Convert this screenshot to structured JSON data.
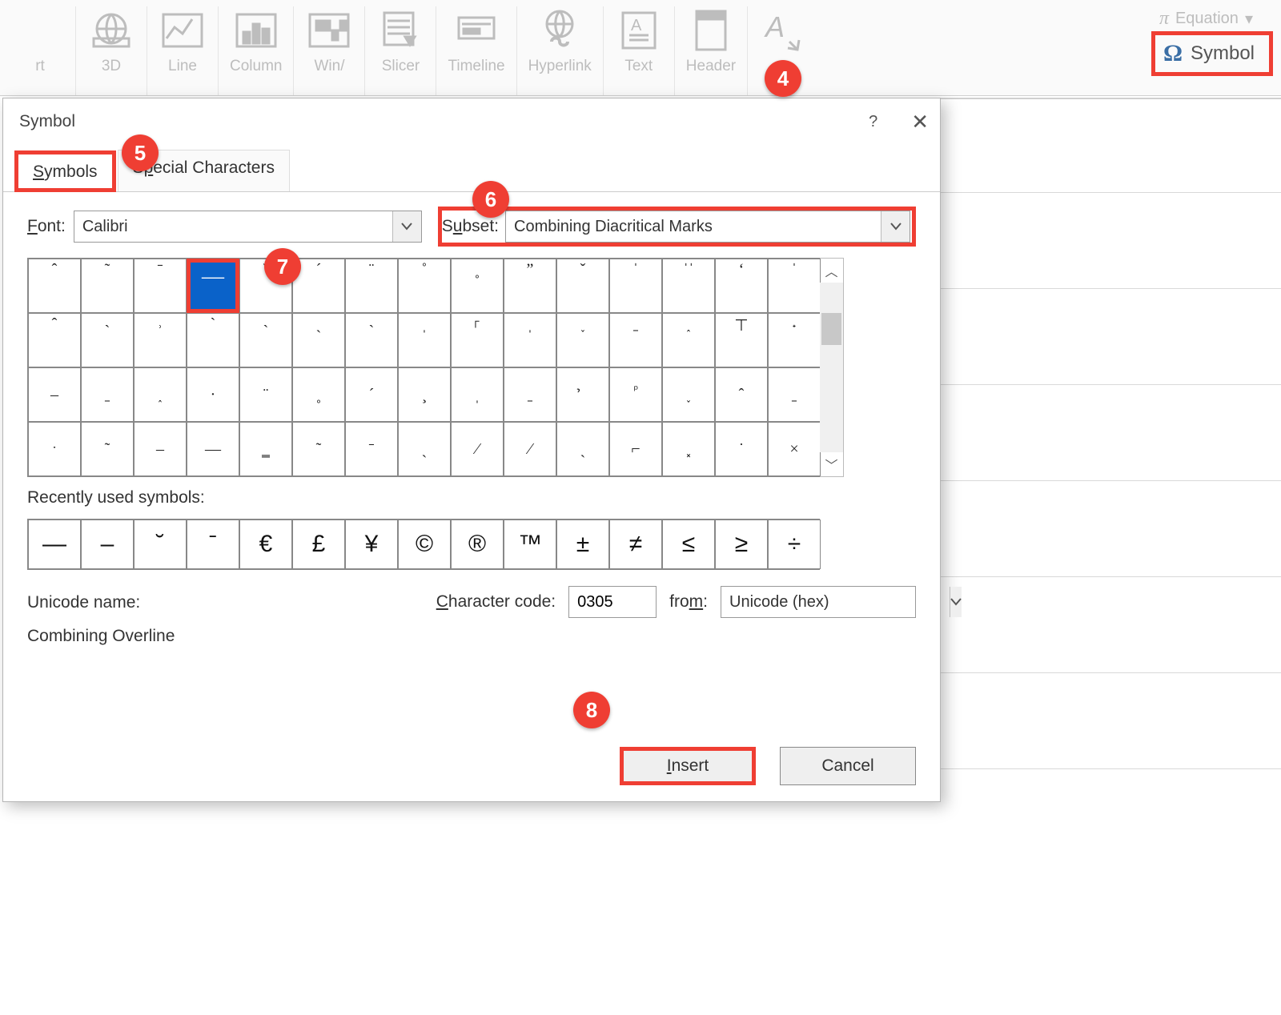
{
  "ribbon": {
    "items": [
      {
        "label": "rt"
      },
      {
        "label": "3D"
      },
      {
        "label": "Line"
      },
      {
        "label": "Column"
      },
      {
        "label": "Win/"
      },
      {
        "label": "Slicer"
      },
      {
        "label": "Timeline"
      },
      {
        "label": "Hyperlink"
      },
      {
        "label": "Text"
      },
      {
        "label": "Header"
      }
    ],
    "equation_label": "Equation",
    "symbol_label": "Symbol"
  },
  "dialog": {
    "title": "Symbol",
    "help": "?",
    "tabs": {
      "symbols": "Symbols",
      "special": "Special Characters"
    },
    "font_label": "Font:",
    "font_value": "Calibri",
    "subset_label": "Subset:",
    "subset_value": "Combining Diacritical Marks",
    "grid_rows": [
      [
        "ˆ",
        "˜",
        "ˉ",
        "ˉ",
        "˘",
        "´",
        "¨",
        "˚",
        "˳",
        "ˮ",
        "ˇ",
        "ˈ",
        "ˈˈ",
        "‘",
        "ˈ"
      ],
      [
        "ˆ",
        "˴",
        "˒",
        "ˋ",
        "˴",
        "ˎ",
        "˴",
        "ˌ",
        "⸀",
        "ˌ",
        "˯",
        "ˍ",
        "˰",
        "⊤",
        "˖"
      ],
      [
        "–",
        "ˍ",
        "˰",
        "·",
        "¨",
        "˳",
        "´",
        "¸",
        "ˌ",
        "ˍ",
        "᷎",
        "ᷮ",
        "˯",
        "ˆ",
        "ˍ"
      ],
      [
        "ˑ",
        "˜",
        "–",
        "—",
        "͇",
        "˜",
        "ˉ",
        "ˎ",
        "⁄",
        "∕",
        "ˏ",
        "⌐",
        "͓",
        "˙",
        "×"
      ]
    ],
    "selected": {
      "row": 0,
      "col": 3
    },
    "recent_label": "Recently used symbols:",
    "recent": [
      "—",
      "–",
      "˘",
      "ˉ",
      "€",
      "£",
      "¥",
      "©",
      "®",
      "™",
      "±",
      "≠",
      "≤",
      "≥",
      "÷"
    ],
    "unicode_name_label": "Unicode name:",
    "unicode_name": "Combining Overline",
    "char_code_label": "Character code:",
    "char_code": "0305",
    "from_label": "from:",
    "from_value": "Unicode (hex)",
    "insert": "Insert",
    "cancel": "Cancel"
  },
  "callouts": {
    "4": "4",
    "5": "5",
    "6": "6",
    "7": "7",
    "8": "8"
  }
}
